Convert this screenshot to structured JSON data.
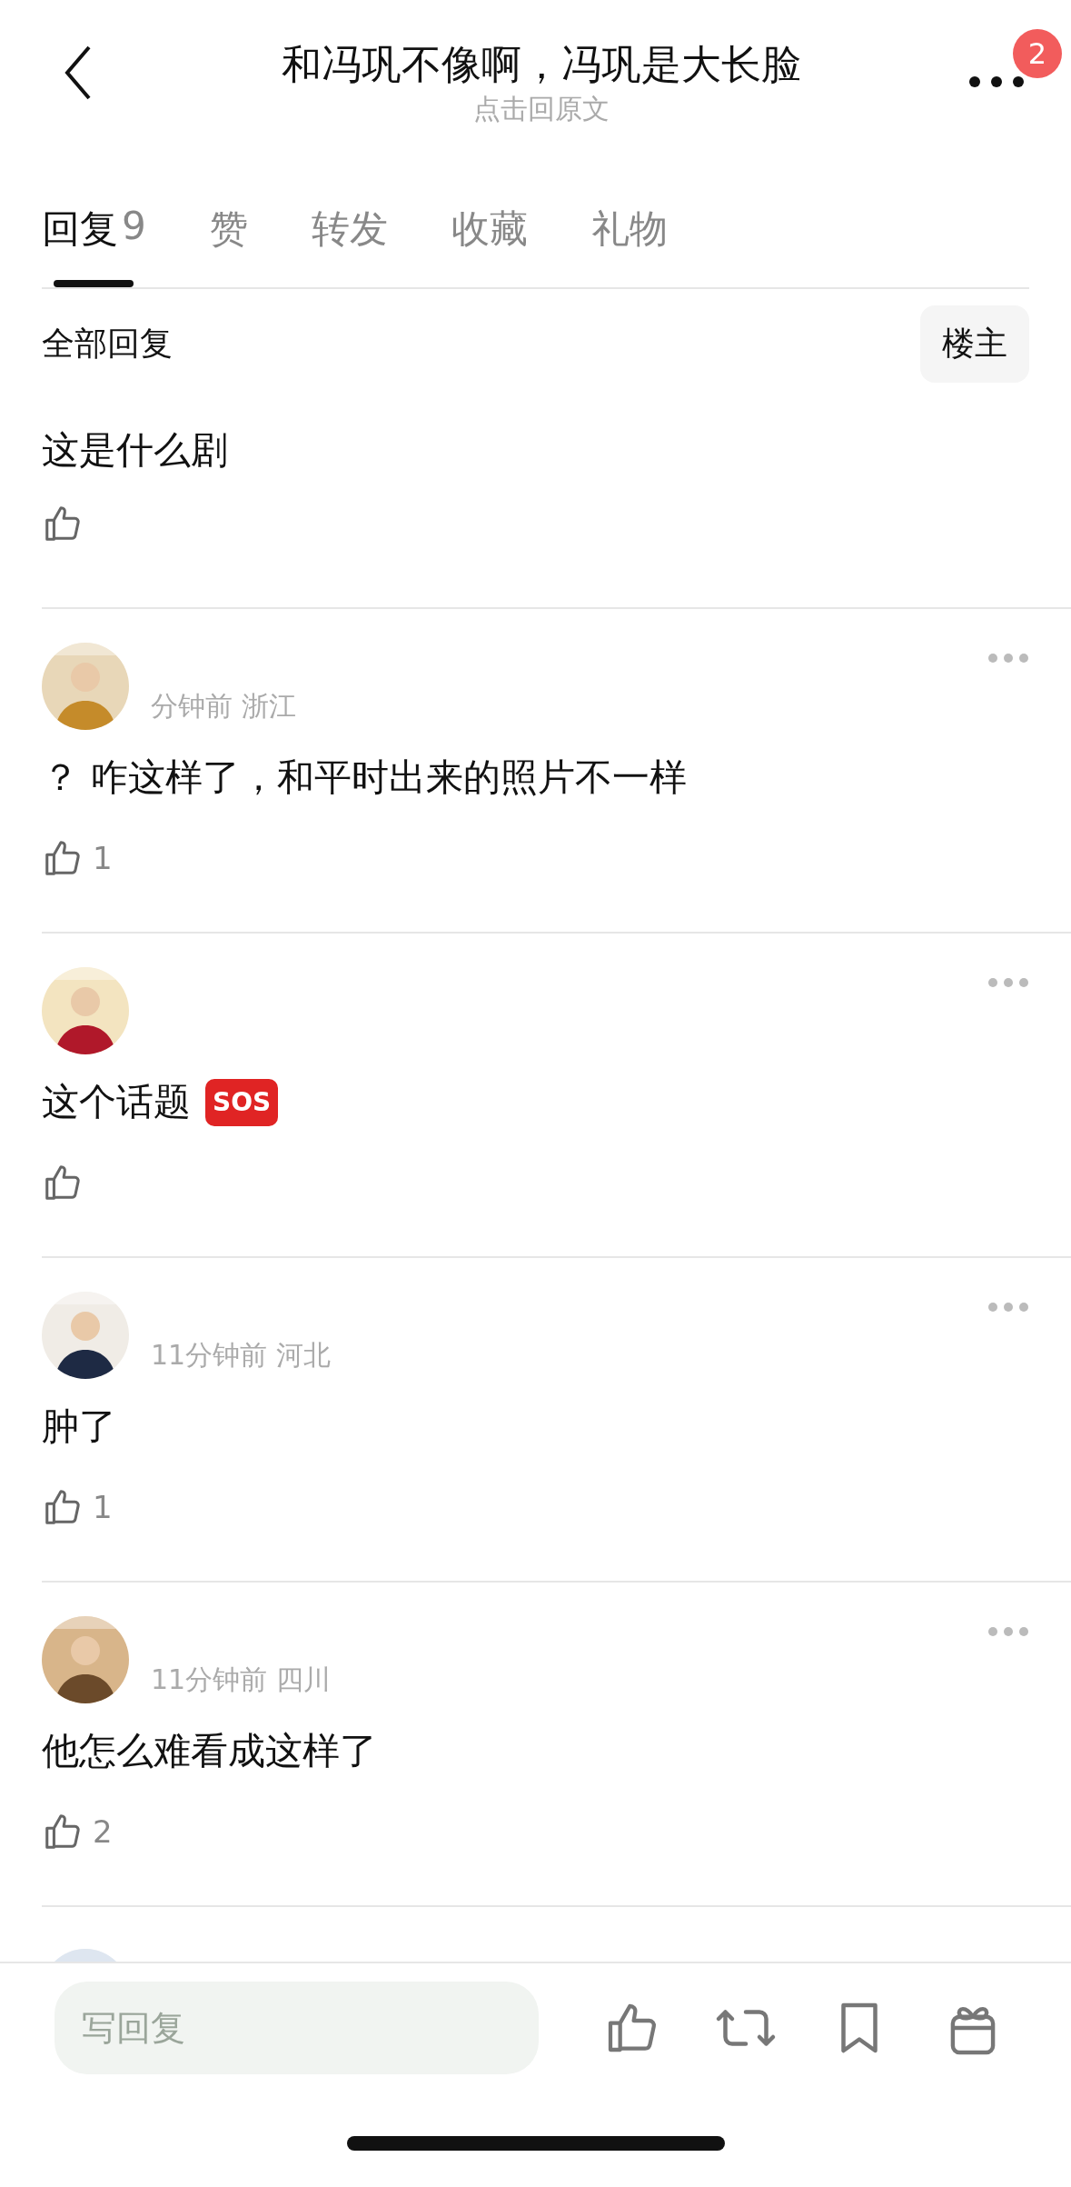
{
  "header": {
    "title": "和冯巩不像啊，冯巩是大长脸",
    "subtitle": "点击回原文",
    "badge": "2"
  },
  "tabs": [
    {
      "label": "回复",
      "count": "9",
      "selected": true
    },
    {
      "label": "赞",
      "selected": false
    },
    {
      "label": "转发",
      "selected": false
    },
    {
      "label": "收藏",
      "selected": false
    },
    {
      "label": "礼物",
      "selected": false
    }
  ],
  "section": {
    "title": "全部回复",
    "filter": "楼主"
  },
  "comments": [
    {
      "kind": "cut",
      "text": "这是什么剧"
    },
    {
      "kind": "full",
      "meta": "分钟前 浙江",
      "text": "？ 咋这样了，和平时出来的照片不一样",
      "likes": "1"
    },
    {
      "kind": "full",
      "text": "这个话题",
      "badge": "SOS"
    },
    {
      "kind": "full",
      "meta": "11分钟前 河北",
      "text": "肿了",
      "likes": "1"
    },
    {
      "kind": "full",
      "meta": "11分钟前 四川",
      "text": "他怎么难看成这样了",
      "likes": "2"
    },
    {
      "kind": "peek"
    }
  ],
  "composer": {
    "placeholder": "写回复"
  }
}
